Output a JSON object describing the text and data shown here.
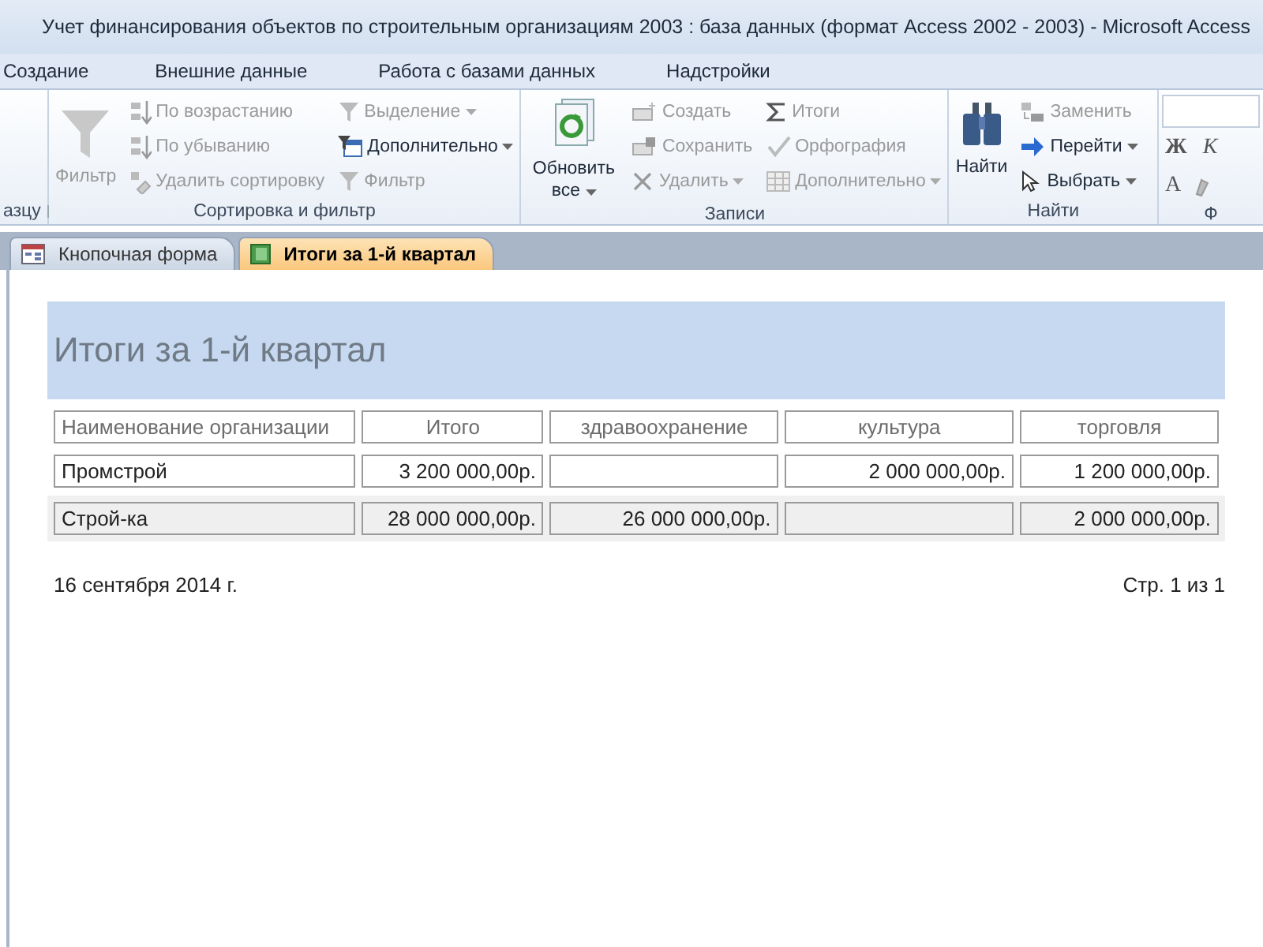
{
  "window": {
    "title": "Учет финансирования объектов по строительным организациям 2003 : база данных (формат Access 2002 - 2003)  -  Microsoft Access"
  },
  "menu_tabs": [
    "Создание",
    "Внешние данные",
    "Работа с базами данных",
    "Надстройки"
  ],
  "ribbon": {
    "groups": [
      {
        "label": "азцу"
      },
      {
        "label": "Сортировка и фильтр",
        "commands": [
          {
            "label": "Фильтр",
            "disabled": true
          },
          {
            "label": "По возрастанию",
            "disabled": true
          },
          {
            "label": "По убыванию",
            "disabled": true
          },
          {
            "label": "Удалить сортировку",
            "disabled": true
          },
          {
            "label": "Выделение",
            "disabled": true
          },
          {
            "label": "Дополнительно",
            "disabled": false
          },
          {
            "label": "Фильтр",
            "disabled": true
          }
        ]
      },
      {
        "label": "Записи",
        "commands": [
          {
            "label": "Обновить все",
            "disabled": false
          },
          {
            "label": "Создать",
            "disabled": true
          },
          {
            "label": "Сохранить",
            "disabled": true
          },
          {
            "label": "Удалить",
            "disabled": true
          },
          {
            "label": "Итоги",
            "disabled": true
          },
          {
            "label": "Орфография",
            "disabled": true
          },
          {
            "label": "Дополнительно",
            "disabled": true
          }
        ]
      },
      {
        "label": "Найти",
        "commands": [
          {
            "label": "Найти",
            "disabled": false
          },
          {
            "label": "Заменить",
            "disabled": true
          },
          {
            "label": "Перейти",
            "disabled": false
          },
          {
            "label": "Выбрать",
            "disabled": false
          }
        ]
      },
      {
        "label": "Ф",
        "glyphs": [
          "Ж",
          "К",
          "A"
        ]
      }
    ]
  },
  "doc_tabs": [
    {
      "label": "Кнопочная форма",
      "selected": false
    },
    {
      "label": "Итоги за 1-й квартал",
      "selected": true
    }
  ],
  "report": {
    "title": "Итоги за 1-й квартал",
    "columns": [
      "Наименование организации",
      "Итого",
      "здравоохранение",
      "культура",
      "торговля"
    ],
    "rows": [
      [
        "Промстрой",
        "3 200 000,00р.",
        null,
        "2 000 000,00р.",
        "1 200 000,00р."
      ],
      [
        "Строй-ка",
        "28 000 000,00р.",
        "26 000 000,00р.",
        null,
        "2 000 000,00р."
      ]
    ],
    "date": "16 сентября 2014 г.",
    "page": "Стр. 1 из 1"
  }
}
